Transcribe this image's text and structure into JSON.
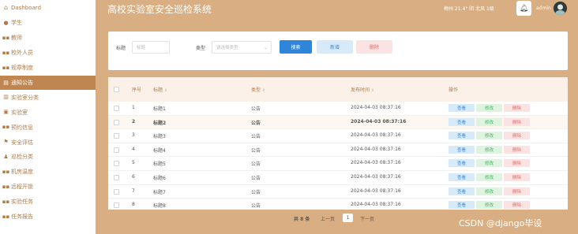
{
  "app": {
    "title": "高校实验室安全巡检系统"
  },
  "header": {
    "weather": "梅州  21.4°  阴  北风  1级",
    "user_name": "admin"
  },
  "sidebar": {
    "items": [
      {
        "label": "Dashboard",
        "icon": "home-icon"
      },
      {
        "label": "学生",
        "icon": "user-icon"
      },
      {
        "label": "教师",
        "icon": "grid-icon"
      },
      {
        "label": "校外人员",
        "icon": "grid-icon"
      },
      {
        "label": "规章制度",
        "icon": "grid-icon"
      },
      {
        "label": "通知公告",
        "icon": "document-icon",
        "active": true
      },
      {
        "label": "实验室分类",
        "icon": "bar-chart-icon"
      },
      {
        "label": "实验室",
        "icon": "image-icon"
      },
      {
        "label": "预约信息",
        "icon": "grid-icon"
      },
      {
        "label": "安全评估",
        "icon": "flag-icon"
      },
      {
        "label": "巡检分类",
        "icon": "person-icon"
      },
      {
        "label": "机房温度",
        "icon": "grid-icon"
      },
      {
        "label": "远程开锁",
        "icon": "grid-icon"
      },
      {
        "label": "实验任务",
        "icon": "grid-icon"
      },
      {
        "label": "任务报告",
        "icon": "grid-icon"
      }
    ]
  },
  "search": {
    "title_label": "标题",
    "title_placeholder": "标题",
    "type_label": "类型",
    "type_placeholder": "请选择类型",
    "search_button": "搜索",
    "add_button": "新增",
    "delete_button": "删除"
  },
  "table": {
    "columns": [
      "序号",
      "标题",
      "类型",
      "发布时间",
      "操作"
    ],
    "actions": {
      "view": "查看",
      "edit": "修改",
      "delete": "删除"
    },
    "rows": [
      {
        "index": "1",
        "title": "标题1",
        "type": "公告",
        "time": "2024-04-03 08:37:16"
      },
      {
        "index": "2",
        "title": "标题2",
        "type": "公告",
        "time": "2024-04-03 08:37:16"
      },
      {
        "index": "3",
        "title": "标题3",
        "type": "公告",
        "time": "2024-04-03 08:37:16"
      },
      {
        "index": "4",
        "title": "标题4",
        "type": "公告",
        "time": "2024-04-03 08:37:16"
      },
      {
        "index": "5",
        "title": "标题5",
        "type": "公告",
        "time": "2024-04-03 08:37:16"
      },
      {
        "index": "6",
        "title": "标题6",
        "type": "公告",
        "time": "2024-04-03 08:37:16"
      },
      {
        "index": "7",
        "title": "标题7",
        "type": "公告",
        "time": "2024-04-03 08:37:16"
      },
      {
        "index": "8",
        "title": "标题8",
        "type": "公告",
        "time": "2024-04-03 08:37:16"
      }
    ]
  },
  "pagination": {
    "total": "共 8 条",
    "prev": "上一页",
    "current": "1",
    "next": "下一页"
  },
  "watermark": "CSDN @django毕设",
  "colors": {
    "background": "#d9ae82",
    "sidebar_active": "#c08652",
    "accent_text": "#b07b48",
    "primary": "#2f86d8",
    "danger": "#e46a6a",
    "success": "#4caf64"
  }
}
